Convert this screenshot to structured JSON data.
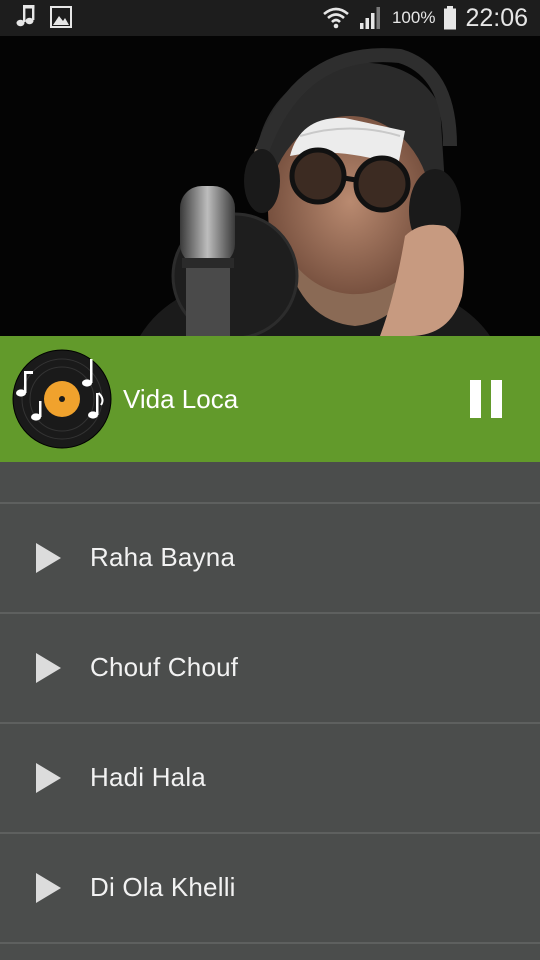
{
  "status_bar": {
    "battery": "100%",
    "time": "22:06",
    "icons": [
      "music-note-icon",
      "image-icon",
      "wifi-icon",
      "signal-icon",
      "battery-icon"
    ]
  },
  "now_playing": {
    "title": "Vida Loca",
    "control": "pause-icon",
    "accent_color": "#629a2b"
  },
  "tracks": [
    {
      "title": "Raha Bayna"
    },
    {
      "title": "Chouf Chouf"
    },
    {
      "title": "Hadi Hala"
    },
    {
      "title": "Di Ola Khelli"
    }
  ]
}
